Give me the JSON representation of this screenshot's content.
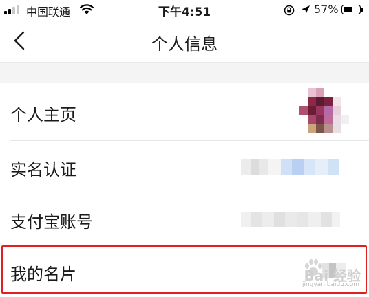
{
  "status_bar": {
    "carrier": "中国联通",
    "time": "下午4:51",
    "battery_percent": "57%",
    "battery_level": 0.57,
    "signal_bars_filled": 2,
    "icons": [
      "signal-icon",
      "wifi-icon",
      "rotation-lock-icon",
      "location-arrow-icon",
      "battery-icon"
    ]
  },
  "nav": {
    "back_icon": "chevron-left-icon",
    "title": "个人信息"
  },
  "list": {
    "items": [
      {
        "label": "个人主页",
        "value_type": "avatar-pixelated"
      },
      {
        "label": "实名认证",
        "value_type": "blurred-text"
      },
      {
        "label": "支付宝账号",
        "value_type": "blurred-text"
      },
      {
        "label": "我的名片",
        "value_type": "blurred-icon",
        "highlighted": true
      }
    ]
  },
  "colors": {
    "highlight": "#e02020",
    "section_gap": "#f4f4f4",
    "divider": "#e6e6e6"
  },
  "watermark": {
    "text": "Bai 经验",
    "url": "jingyan.baidu.com"
  }
}
